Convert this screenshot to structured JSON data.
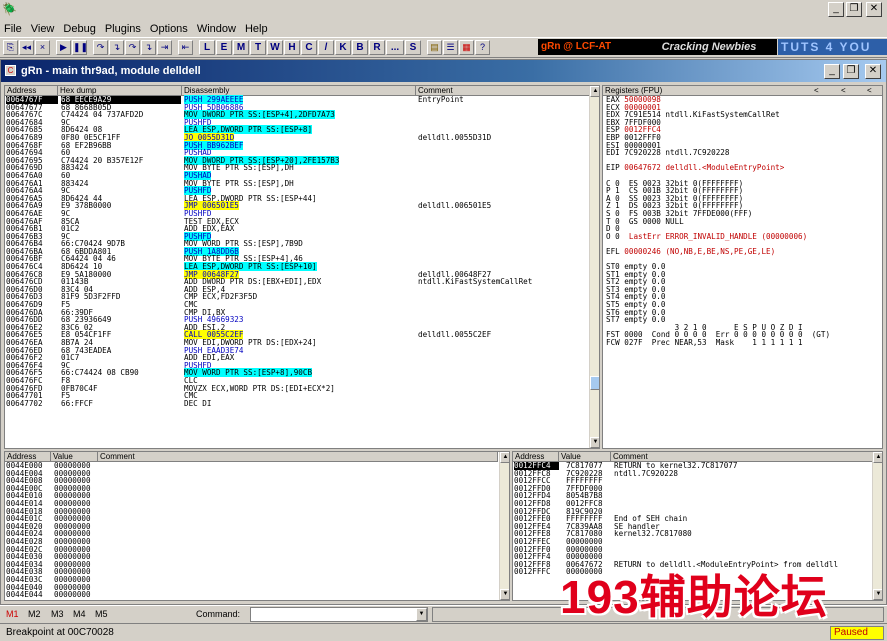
{
  "window": {
    "title": "",
    "minimize": "_",
    "restore": "❐",
    "close": "✕"
  },
  "menu": [
    "File",
    "View",
    "Debug",
    "Plugins",
    "Options",
    "Window",
    "Help"
  ],
  "toolbar": {
    "icons": [
      "⎘",
      "◂◂",
      "×",
      "▶",
      "❚❚",
      "↷",
      "↴",
      "↷",
      "↴",
      "⇥",
      "⇤"
    ],
    "letters": [
      "L",
      "E",
      "M",
      "T",
      "W",
      "H",
      "C",
      "/",
      "K",
      "B",
      "R",
      "...",
      "S"
    ],
    "banners": {
      "grn": "gRn @ LCF-AT",
      "crack": "Cracking Newbies",
      "tuts": "TUTS 4 YOU"
    }
  },
  "child": {
    "title": "gRn - main thr9ad, module delldell",
    "min": "_",
    "restore": "❐",
    "close": "✕"
  },
  "cpu": {
    "headers": [
      "Address",
      "Hex dump",
      "Disassembly",
      "Comment"
    ],
    "rows": [
      [
        "0064767F",
        "68 EECE9A29",
        "PUSH 299AEEEE",
        "EntryPoint"
      ],
      [
        "00647677",
        "68 8668B05D",
        "PUSH 5DB06886",
        ""
      ],
      [
        "0064767C",
        "C74424 04 737AFD2D",
        "MOV DWORD PTR SS:[ESP+4],2DFD7A73",
        ""
      ],
      [
        "00647684",
        "9C",
        "PUSHFD",
        ""
      ],
      [
        "00647685",
        "8D6424 08",
        "LEA ESP,DWORD PTR SS:[ESP+8]",
        ""
      ],
      [
        "00647689",
        "0F80 0E5CF1FF",
        "JO 0055D31D",
        "delldll.0055D31D"
      ],
      [
        "0064768F",
        "68 EF2B96BB",
        "PUSH BB962BEF",
        ""
      ],
      [
        "00647694",
        "60",
        "PUSHAD",
        ""
      ],
      [
        "00647695",
        "C74424 20 B357E12F",
        "MOV DWORD PTR SS:[ESP+20],2FE157B3",
        ""
      ],
      [
        "0064769D",
        "883424",
        "MOV BYTE PTR SS:[ESP],DH",
        ""
      ],
      [
        "006476A0",
        "60",
        "PUSHAD",
        ""
      ],
      [
        "006476A1",
        "883424",
        "MOV BYTE PTR SS:[ESP],DH",
        ""
      ],
      [
        "006476A4",
        "9C",
        "PUSHFD",
        ""
      ],
      [
        "006476A5",
        "8D6424 44",
        "LEA ESP,DWORD PTR SS:[ESP+44]",
        ""
      ],
      [
        "006476A9",
        "E9 378B0000",
        "JMP 006501E5",
        "delldll.006501E5"
      ],
      [
        "006476AE",
        "9C",
        "PUSHFD",
        ""
      ],
      [
        "006476AF",
        "85CA",
        "TEST EDX,ECX",
        ""
      ],
      [
        "006476B1",
        "01C2",
        "ADD EDX,EAX",
        ""
      ],
      [
        "006476B3",
        "9C",
        "PUSHFD",
        ""
      ],
      [
        "006476B4",
        "66:C70424 9D7B",
        "MOV WORD PTR SS:[ESP],7B9D",
        ""
      ],
      [
        "006476BA",
        "68 6BDDA801",
        "PUSH 1A8DD6B",
        ""
      ],
      [
        "006476BF",
        "C64424 04 46",
        "MOV BYTE PTR SS:[ESP+4],46",
        ""
      ],
      [
        "006476C4",
        "8D6424 10",
        "LEA ESP,DWORD PTR SS:[ESP+10]",
        ""
      ],
      [
        "006476C8",
        "E9 5A180000",
        "JMP 00648F27",
        "delldll.00648F27"
      ],
      [
        "006476CD",
        "01143B",
        "ADD DWORD PTR DS:[EBX+EDI],EDX",
        "ntdll.KiFastSystemCallRet"
      ],
      [
        "006476D0",
        "83C4 04",
        "ADD ESP,4",
        ""
      ],
      [
        "006476D3",
        "81F9 5D3F2FFD",
        "CMP ECX,FD2F3F5D",
        ""
      ],
      [
        "006476D9",
        "F5",
        "CMC",
        ""
      ],
      [
        "006476DA",
        "66:39DF",
        "CMP DI,BX",
        ""
      ],
      [
        "006476DD",
        "68 23936649",
        "PUSH 49669323",
        ""
      ],
      [
        "006476E2",
        "83C6 02",
        "ADD ESI,2",
        ""
      ],
      [
        "006476E5",
        "E8 054CF1FF",
        "CALL 0055C2EF",
        "delldll.0055C2EF"
      ],
      [
        "006476EA",
        "8B7A 24",
        "MOV EDI,DWORD PTR DS:[EDX+24]",
        ""
      ],
      [
        "006476ED",
        "68 743EADEA",
        "PUSH EAAD3E74",
        ""
      ],
      [
        "006476F2",
        "01C7",
        "ADD EDI,EAX",
        ""
      ],
      [
        "006476F4",
        "9C",
        "PUSHFD",
        ""
      ],
      [
        "006476F5",
        "66:C74424 08 CB90",
        "MOV WORD PTR SS:[ESP+8],90CB",
        ""
      ],
      [
        "006476FC",
        "F8",
        "CLC",
        ""
      ],
      [
        "006476FD",
        "0FB70C4F",
        "MOVZX ECX,WORD PTR DS:[EDI+ECX*2]",
        ""
      ],
      [
        "00647701",
        "F5",
        "CMC",
        ""
      ],
      [
        "00647702",
        "66:FFCF",
        "DEC DI",
        ""
      ]
    ]
  },
  "registers": {
    "header": "Registers (FPU)",
    "nav": [
      "<",
      "<",
      "<",
      "<"
    ],
    "lines": [
      "EAX 50000098",
      "ECX 00000001",
      "EDX 7C91E514 ntdll.KiFastSystemCallRet",
      "EBX 7FFDF000",
      "ESP 0012FFC4",
      "EBP 0012FFF0",
      "ESI 00000001",
      "EDI 7C920228 ntdll.7C920228",
      "",
      "EIP 00647672 delldll.<ModuleEntryPoint>",
      "",
      "C 0  ES 0023 32bit 0(FFFFFFFF)",
      "P 1  CS 001B 32bit 0(FFFFFFFF)",
      "A 0  SS 0023 32bit 0(FFFFFFFF)",
      "Z 1  DS 0023 32bit 0(FFFFFFFF)",
      "S 0  FS 003B 32bit 7FFDE000(FFF)",
      "T 0  GS 0000 NULL",
      "D 0",
      "O 0  LastErr ERROR_INVALID_HANDLE (00000006)",
      "",
      "EFL 00000246 (NO,NB,E,BE,NS,PE,GE,LE)",
      "",
      "ST0 empty 0.0",
      "ST1 empty 0.0",
      "ST2 empty 0.0",
      "ST3 empty 0.0",
      "ST4 empty 0.0",
      "ST5 empty 0.0",
      "ST6 empty 0.0",
      "ST7 empty 0.0",
      "               3 2 1 0      E S P U O Z D I",
      "FST 0000  Cond 0 0 0 0  Err 0 0 0 0 0 0 0 0  (GT)",
      "FCW 027F  Prec NEAR,53  Mask    1 1 1 1 1 1"
    ]
  },
  "dump": {
    "headers": [
      "Address",
      "Value",
      "Comment"
    ],
    "rows": [
      [
        "0044E000",
        "00000000"
      ],
      [
        "0044E004",
        "00000000"
      ],
      [
        "0044E008",
        "00000000"
      ],
      [
        "0044E00C",
        "00000000"
      ],
      [
        "0044E010",
        "00000000"
      ],
      [
        "0044E014",
        "00000000"
      ],
      [
        "0044E018",
        "00000000"
      ],
      [
        "0044E01C",
        "00000000"
      ],
      [
        "0044E020",
        "00000000"
      ],
      [
        "0044E024",
        "00000000"
      ],
      [
        "0044E028",
        "00000000"
      ],
      [
        "0044E02C",
        "00000000"
      ],
      [
        "0044E030",
        "00000000"
      ],
      [
        "0044E034",
        "00000000"
      ],
      [
        "0044E038",
        "00000000"
      ],
      [
        "0044E03C",
        "00000000"
      ],
      [
        "0044E040",
        "00000000"
      ],
      [
        "0044E044",
        "00000000"
      ]
    ]
  },
  "stack": {
    "headers": [
      "Address",
      "Value",
      "Comment"
    ],
    "rows": [
      [
        "0012FFC4",
        "7C817077",
        "RETURN to kernel32.7C817077"
      ],
      [
        "0012FFC8",
        "7C920228",
        "ntdll.7C920228"
      ],
      [
        "0012FFCC",
        "FFFFFFFF",
        ""
      ],
      [
        "0012FFD0",
        "7FFDF000",
        ""
      ],
      [
        "0012FFD4",
        "8054B7B8",
        ""
      ],
      [
        "0012FFD8",
        "0012FFC8",
        ""
      ],
      [
        "0012FFDC",
        "819C9020",
        ""
      ],
      [
        "0012FFE0",
        "FFFFFFFF",
        "End of SEH chain"
      ],
      [
        "0012FFE4",
        "7C839AA8",
        "SE handler"
      ],
      [
        "0012FFE8",
        "7C817080",
        "kernel32.7C817080"
      ],
      [
        "0012FFEC",
        "00000000",
        ""
      ],
      [
        "0012FFF0",
        "00000000",
        ""
      ],
      [
        "0012FFF4",
        "00000000",
        ""
      ],
      [
        "0012FFF8",
        "00647672",
        "RETURN to delldll.<ModuleEntryPoint> from delldll"
      ],
      [
        "0012FFFC",
        "00000000",
        ""
      ]
    ]
  },
  "command": {
    "marks": [
      "M1",
      "M2",
      "M3",
      "M4",
      "M5"
    ],
    "label": "Command:",
    "value": ""
  },
  "status": {
    "text": "Breakpoint at 00C70028",
    "state": "Paused"
  },
  "watermark": "193辅助论坛",
  "colors": {
    "accent_cyan": "#00ffff",
    "accent_yellow": "#ffff00",
    "paused": "#ffff00",
    "reg_changed": "#c00000"
  }
}
